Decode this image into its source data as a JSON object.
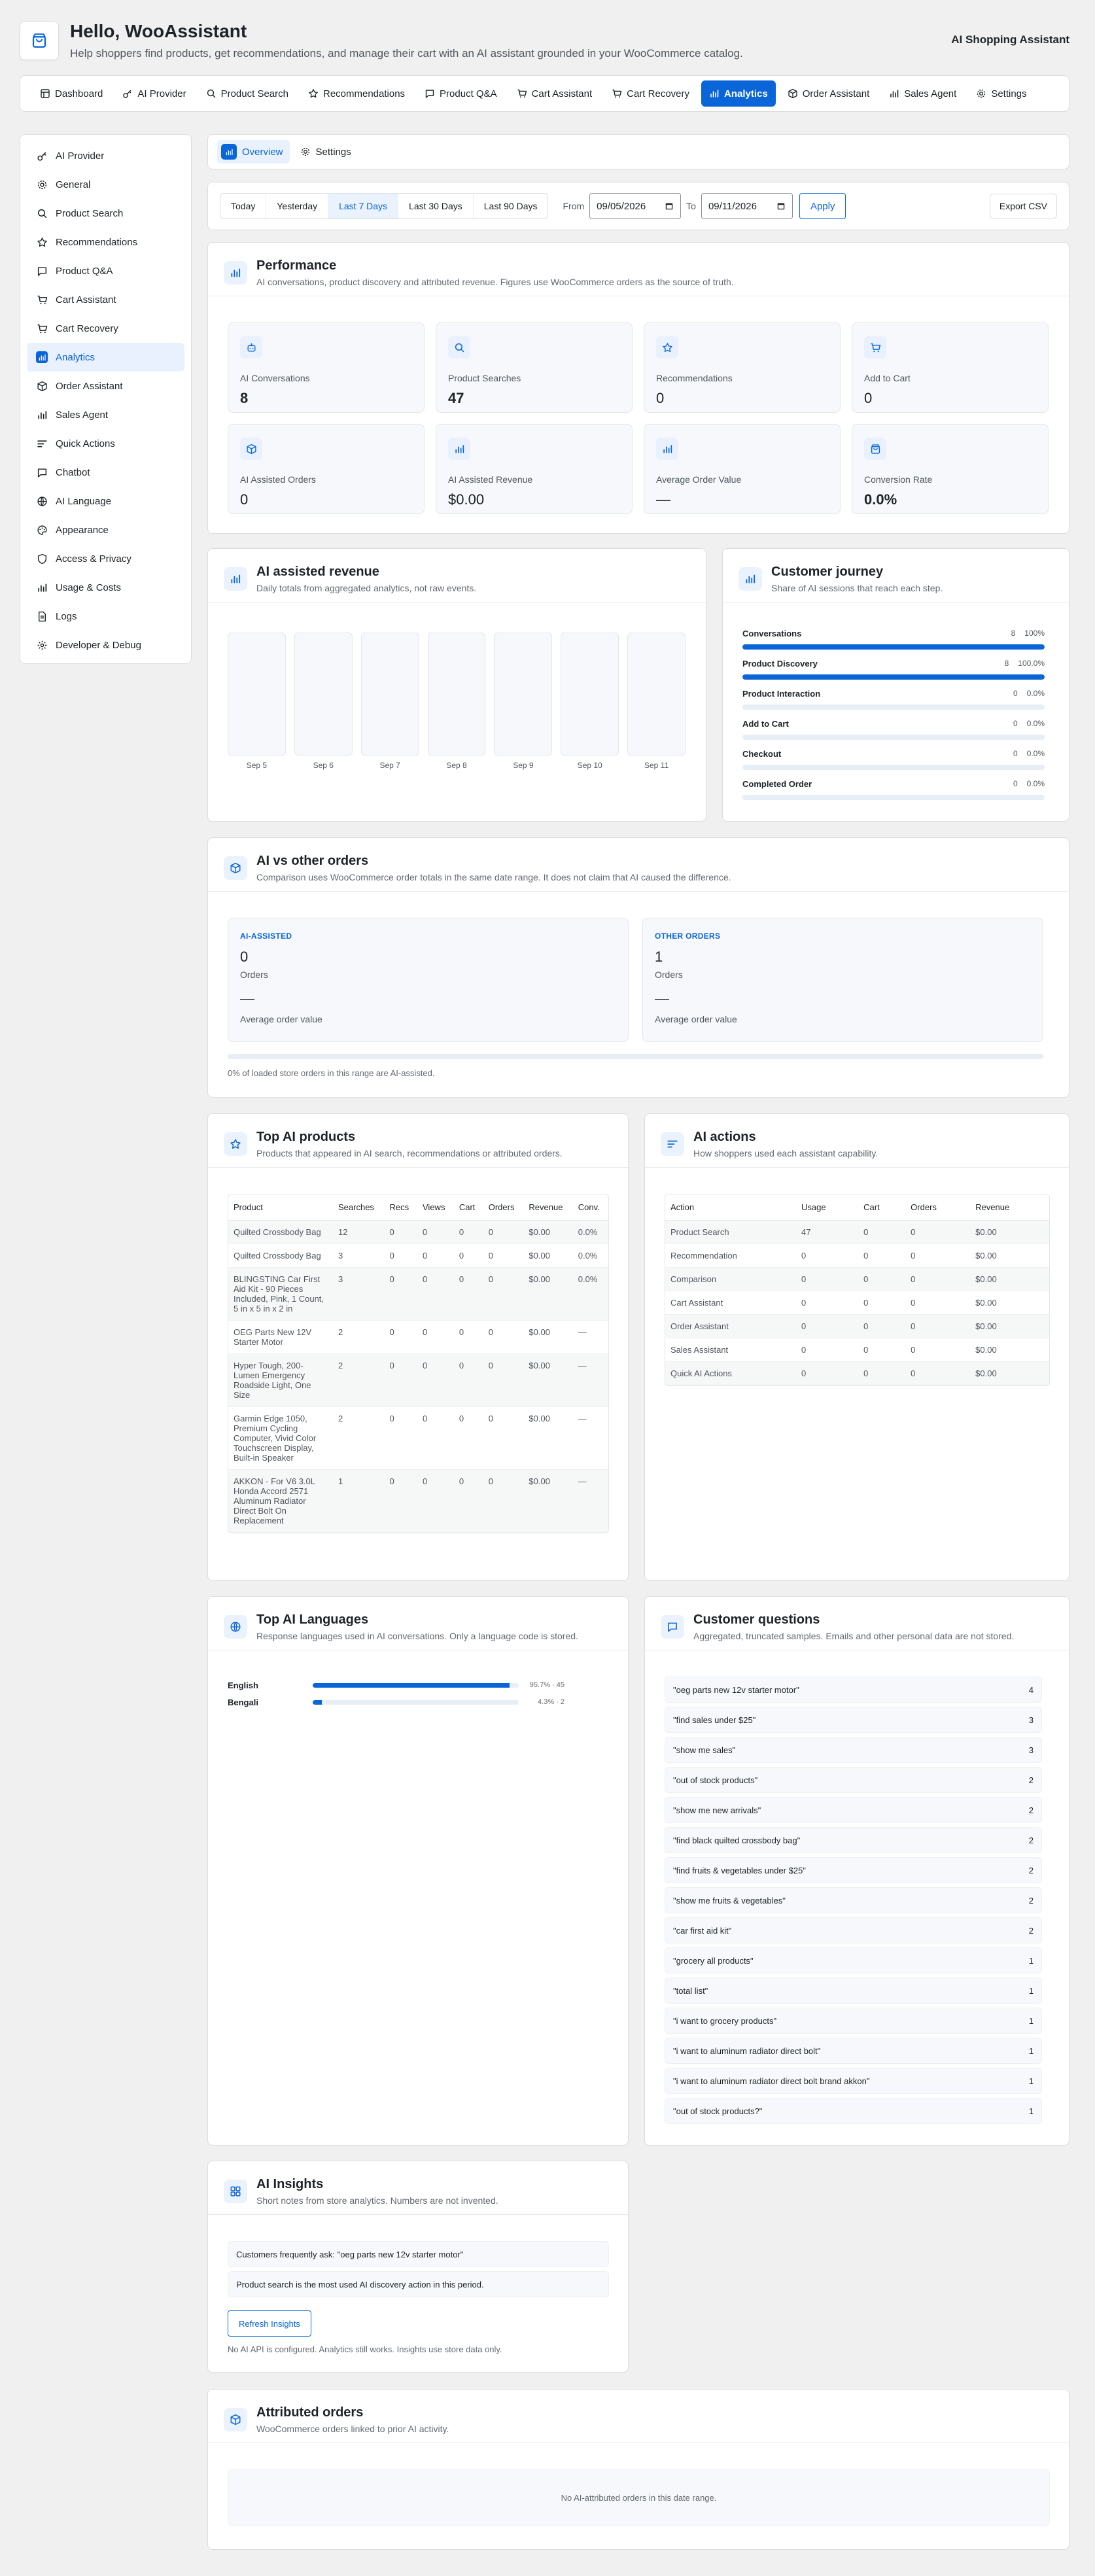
{
  "colors": {
    "accent": "#0a66d8",
    "background": "#f0f0f1"
  },
  "header": {
    "title": "Hello, WooAssistant",
    "subtitle": "Help shoppers find products, get recommendations, and manage their cart with an AI assistant grounded in your WooCommerce catalog.",
    "right_label": "AI Shopping Assistant"
  },
  "topnav": {
    "tabs": [
      {
        "label": "Dashboard",
        "icon": "dashboard-icon"
      },
      {
        "label": "AI Provider",
        "icon": "key-icon"
      },
      {
        "label": "Product Search",
        "icon": "search-icon"
      },
      {
        "label": "Recommendations",
        "icon": "star-icon"
      },
      {
        "label": "Product Q&A",
        "icon": "chat-icon"
      },
      {
        "label": "Cart Assistant",
        "icon": "cart-icon"
      },
      {
        "label": "Cart Recovery",
        "icon": "cart-icon"
      },
      {
        "label": "Analytics",
        "icon": "chart-icon",
        "active": true
      },
      {
        "label": "Order Assistant",
        "icon": "box-icon"
      },
      {
        "label": "Sales Agent",
        "icon": "chart-icon"
      },
      {
        "label": "Settings",
        "icon": "gear-icon"
      }
    ]
  },
  "sidebar": {
    "items": [
      {
        "label": "AI Provider",
        "icon": "key-icon"
      },
      {
        "label": "General",
        "icon": "gear-icon"
      },
      {
        "label": "Product Search",
        "icon": "search-icon"
      },
      {
        "label": "Recommendations",
        "icon": "star-icon"
      },
      {
        "label": "Product Q&A",
        "icon": "chat-icon"
      },
      {
        "label": "Cart Assistant",
        "icon": "cart-icon"
      },
      {
        "label": "Cart Recovery",
        "icon": "cart-icon"
      },
      {
        "label": "Analytics",
        "icon": "chart-icon",
        "active": true
      },
      {
        "label": "Order Assistant",
        "icon": "box-icon"
      },
      {
        "label": "Sales Agent",
        "icon": "chart-icon"
      },
      {
        "label": "Quick Actions",
        "icon": "actions-icon"
      },
      {
        "label": "Chatbot",
        "icon": "chat-icon"
      },
      {
        "label": "AI Language",
        "icon": "globe-icon"
      },
      {
        "label": "Appearance",
        "icon": "palette-icon"
      },
      {
        "label": "Access & Privacy",
        "icon": "shield-icon"
      },
      {
        "label": "Usage & Costs",
        "icon": "chart-icon"
      },
      {
        "label": "Logs",
        "icon": "document-icon"
      },
      {
        "label": "Developer & Debug",
        "icon": "code-icon"
      }
    ]
  },
  "subtabs": {
    "overview": "Overview",
    "settings": "Settings"
  },
  "filters": {
    "ranges": [
      "Today",
      "Yesterday",
      "Last 7 Days",
      "Last 30 Days",
      "Last 90 Days"
    ],
    "active_range": "Last 7 Days",
    "from_label": "From",
    "from_value": "09/05/2026",
    "to_label": "To",
    "to_value": "09/11/2026",
    "apply": "Apply",
    "export": "Export CSV"
  },
  "performance": {
    "title": "Performance",
    "subtitle": "AI conversations, product discovery and attributed revenue. Figures use WooCommerce orders as the source of truth.",
    "metrics": [
      {
        "label": "AI Conversations",
        "value": "8",
        "icon": "robot-icon",
        "bold": true
      },
      {
        "label": "Product Searches",
        "value": "47",
        "icon": "search-icon",
        "bold": true
      },
      {
        "label": "Recommendations",
        "value": "0",
        "icon": "star-icon"
      },
      {
        "label": "Add to Cart",
        "value": "0",
        "icon": "cart-icon"
      },
      {
        "label": "AI Assisted Orders",
        "value": "0",
        "icon": "box-icon"
      },
      {
        "label": "AI Assisted Revenue",
        "value": "$0.00",
        "icon": "chart-icon"
      },
      {
        "label": "Average Order Value",
        "value": "—",
        "icon": "chart-icon"
      },
      {
        "label": "Conversion Rate",
        "value": "0.0%",
        "icon": "bag-icon",
        "bold": true
      }
    ]
  },
  "revenue": {
    "title": "AI assisted revenue",
    "subtitle": "Daily totals from aggregated analytics, not raw events."
  },
  "chart_data": {
    "type": "bar",
    "categories": [
      "Sep 5",
      "Sep 6",
      "Sep 7",
      "Sep 8",
      "Sep 9",
      "Sep 10",
      "Sep 11"
    ],
    "values": [
      0,
      0,
      0,
      0,
      0,
      0,
      0
    ],
    "title": "AI assisted revenue"
  },
  "journey": {
    "title": "Customer journey",
    "subtitle": "Share of AI sessions that reach each step.",
    "steps": [
      {
        "label": "Conversations",
        "count": "8",
        "pct": "100%",
        "fill": 1.0
      },
      {
        "label": "Product Discovery",
        "count": "8",
        "pct": "100.0%",
        "fill": 1.0
      },
      {
        "label": "Product Interaction",
        "count": "0",
        "pct": "0.0%",
        "fill": 0
      },
      {
        "label": "Add to Cart",
        "count": "0",
        "pct": "0.0%",
        "fill": 0
      },
      {
        "label": "Checkout",
        "count": "0",
        "pct": "0.0%",
        "fill": 0
      },
      {
        "label": "Completed Order",
        "count": "0",
        "pct": "0.0%",
        "fill": 0
      }
    ]
  },
  "compare": {
    "title": "AI vs other orders",
    "subtitle": "Comparison uses WooCommerce order totals in the same date range. It does not claim that AI caused the difference.",
    "ai": {
      "kicker": "AI-ASSISTED",
      "count": "0",
      "count_label": "Orders",
      "aov": "—",
      "aov_label": "Average order value"
    },
    "other": {
      "kicker": "OTHER ORDERS",
      "count": "1",
      "count_label": "Orders",
      "aov": "—",
      "aov_label": "Average order value"
    },
    "share": 0,
    "footnote": "0% of loaded store orders in this range are AI-assisted."
  },
  "top_products": {
    "title": "Top AI products",
    "subtitle": "Products that appeared in AI search, recommendations or attributed orders.",
    "columns": [
      "Product",
      "Searches",
      "Recs",
      "Views",
      "Cart",
      "Orders",
      "Revenue",
      "Conv."
    ],
    "rows": [
      [
        "Quilted Crossbody Bag",
        "12",
        "0",
        "0",
        "0",
        "0",
        "$0.00",
        "0.0%"
      ],
      [
        "Quilted Crossbody Bag",
        "3",
        "0",
        "0",
        "0",
        "0",
        "$0.00",
        "0.0%"
      ],
      [
        "BLINGSTING Car First Aid Kit - 90 Pieces Included, Pink, 1 Count, 5 in x 5 in x 2 in",
        "3",
        "0",
        "0",
        "0",
        "0",
        "$0.00",
        "0.0%"
      ],
      [
        "OEG Parts New 12V Starter Motor",
        "2",
        "0",
        "0",
        "0",
        "0",
        "$0.00",
        "—"
      ],
      [
        "Hyper Tough, 200-Lumen Emergency Roadside Light, One Size",
        "2",
        "0",
        "0",
        "0",
        "0",
        "$0.00",
        "—"
      ],
      [
        "Garmin Edge 1050, Premium Cycling Computer, Vivid Color Touchscreen Display, Built-in Speaker",
        "2",
        "0",
        "0",
        "0",
        "0",
        "$0.00",
        "—"
      ],
      [
        "AKKON - For V6 3.0L Honda Accord 2571 Aluminum Radiator Direct Bolt On Replacement",
        "1",
        "0",
        "0",
        "0",
        "0",
        "$0.00",
        "—"
      ]
    ]
  },
  "ai_actions": {
    "title": "AI actions",
    "subtitle": "How shoppers used each assistant capability.",
    "columns": [
      "Action",
      "Usage",
      "Cart",
      "Orders",
      "Revenue"
    ],
    "rows": [
      [
        "Product Search",
        "47",
        "0",
        "0",
        "$0.00"
      ],
      [
        "Recommendation",
        "0",
        "0",
        "0",
        "$0.00"
      ],
      [
        "Comparison",
        "0",
        "0",
        "0",
        "$0.00"
      ],
      [
        "Cart Assistant",
        "0",
        "0",
        "0",
        "$0.00"
      ],
      [
        "Order Assistant",
        "0",
        "0",
        "0",
        "$0.00"
      ],
      [
        "Sales Assistant",
        "0",
        "0",
        "0",
        "$0.00"
      ],
      [
        "Quick AI Actions",
        "0",
        "0",
        "0",
        "$0.00"
      ]
    ]
  },
  "languages": {
    "title": "Top AI Languages",
    "subtitle": "Response languages used in AI conversations. Only a language code is stored.",
    "items": [
      {
        "name": "English",
        "value": "95.7% · 45",
        "fill": 0.957
      },
      {
        "name": "Bengali",
        "value": "4.3% · 2",
        "fill": 0.043
      }
    ]
  },
  "questions": {
    "title": "Customer questions",
    "subtitle": "Aggregated, truncated samples. Emails and other personal data are not stored.",
    "items": [
      {
        "q": "\"oeg parts new 12v starter motor\"",
        "n": "4"
      },
      {
        "q": "\"find sales under $25\"",
        "n": "3"
      },
      {
        "q": "\"show me sales\"",
        "n": "3"
      },
      {
        "q": "\"out of stock products\"",
        "n": "2"
      },
      {
        "q": "\"show me new arrivals\"",
        "n": "2"
      },
      {
        "q": "\"find black quilted crossbody bag\"",
        "n": "2"
      },
      {
        "q": "\"find fruits & vegetables under $25\"",
        "n": "2"
      },
      {
        "q": "\"show me fruits & vegetables\"",
        "n": "2"
      },
      {
        "q": "\"car first aid kit\"",
        "n": "2"
      },
      {
        "q": "\"grocery all products\"",
        "n": "1"
      },
      {
        "q": "\"total list\"",
        "n": "1"
      },
      {
        "q": "\"i want to grocery products\"",
        "n": "1"
      },
      {
        "q": "\"i want to aluminum radiator direct bolt\"",
        "n": "1"
      },
      {
        "q": "\"i want to aluminum radiator direct bolt brand akkon\"",
        "n": "1"
      },
      {
        "q": "\"out of stock products?\"",
        "n": "1"
      }
    ]
  },
  "insights": {
    "title": "AI Insights",
    "subtitle": "Short notes from store analytics. Numbers are not invented.",
    "items": [
      "Customers frequently ask: \"oeg parts new 12v starter motor\"",
      "Product search is the most used AI discovery action in this period."
    ],
    "button": "Refresh Insights",
    "note": "No AI API is configured. Analytics still works. Insights use store data only."
  },
  "attributed": {
    "title": "Attributed orders",
    "subtitle": "WooCommerce orders linked to prior AI activity.",
    "empty": "No AI-attributed orders in this date range."
  }
}
